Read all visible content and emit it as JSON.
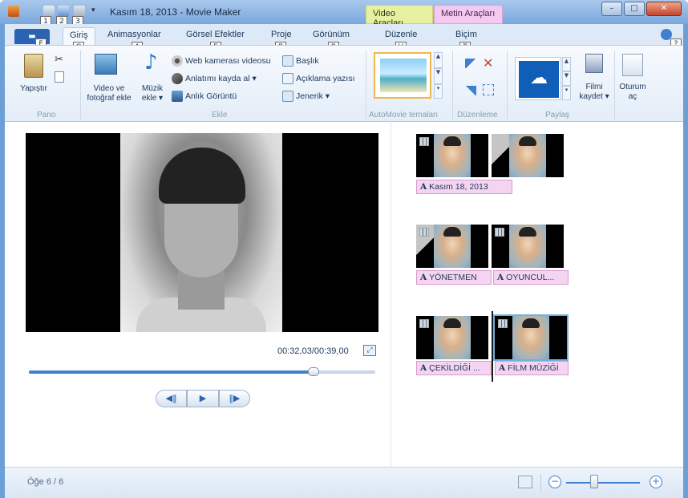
{
  "window": {
    "title": "Kasım 18, 2013 - Movie Maker",
    "controls": {
      "minimize": "–",
      "maximize": "□",
      "close": "✕"
    }
  },
  "quick_access_keytips": [
    "1",
    "2",
    "3"
  ],
  "context_tabs": {
    "video": "Video Araçları",
    "metin": "Metin Araçları"
  },
  "tabs": [
    {
      "label": "Giriş",
      "keytip": "G"
    },
    {
      "label": "Animasyonlar",
      "keytip": "A"
    },
    {
      "label": "Görsel Efektler",
      "keytip": "E"
    },
    {
      "label": "Proje",
      "keytip": "P"
    },
    {
      "label": "Görünüm",
      "keytip": "R"
    },
    {
      "label": "Düzenle",
      "keytip": "V"
    },
    {
      "label": "Biçim",
      "keytip": "T"
    }
  ],
  "file_tab": {
    "keytip": "F"
  },
  "help_keytip": "?",
  "ribbon": {
    "groups": {
      "pano": "Pano",
      "ekle": "Ekle",
      "automovie": "AutoMovie temaları",
      "duzenleme": "Düzenleme",
      "paylas": "Paylaş"
    },
    "paste": "Yapıştır",
    "add_video_l1": "Video ve",
    "add_video_l2": "fotoğraf ekle",
    "add_music_l1": "Müzik",
    "add_music_l2": "ekle ▾",
    "webcam": "Web kamerası videosu",
    "narration": "Anlatımı kayda al ▾",
    "snapshot": "Anlık Görüntü",
    "title": "Başlık",
    "caption": "Açıklama yazısı",
    "credits": "Jenerik ▾",
    "save_movie_l1": "Filmi",
    "save_movie_l2": "kaydet ▾",
    "signin_l1": "Oturum",
    "signin_l2": "aç"
  },
  "preview": {
    "timecode": "00:32,03/00:39,00",
    "progress_fraction": 0.821
  },
  "storyboard": {
    "captions": [
      "Kasım 18, 2013",
      "YÖNETMEN",
      "OYUNCUL...",
      "ÇEKİLDİĞİ ...",
      "FİLM MÜZİĞİ"
    ],
    "caption_marker": "A"
  },
  "status": {
    "item_count": "Öğe 6 / 6"
  },
  "zoom": {
    "minus": "−",
    "plus": "+"
  },
  "colors": {
    "accent": "#2b63b3",
    "video_tools": "#e6f0a0",
    "text_tools": "#f3c9f1",
    "theme_highlight": "#f2b64e"
  },
  "icons": {
    "paste": "clipboard-icon",
    "cut": "scissors-icon",
    "copy": "copy-icon",
    "add_video": "film-photo-icon",
    "add_music": "music-note-icon",
    "webcam": "webcam-icon",
    "narration": "microphone-icon",
    "snapshot": "camera-icon",
    "title": "title-icon",
    "caption": "caption-icon",
    "credits": "credits-icon",
    "onedrive": "cloud-icon",
    "save_movie": "save-movie-icon",
    "signin": "user-icon"
  }
}
